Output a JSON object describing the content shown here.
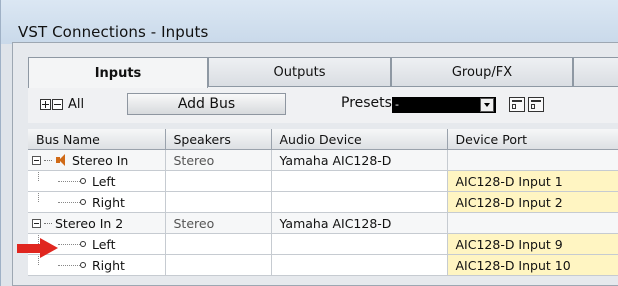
{
  "window": {
    "title": "VST Connections - Inputs"
  },
  "tabs": [
    {
      "label": "Inputs",
      "active": true
    },
    {
      "label": "Outputs",
      "active": false
    },
    {
      "label": "Group/FX",
      "active": false
    }
  ],
  "toolbar": {
    "expand_all_label": "All",
    "add_bus_label": "Add Bus",
    "presets_label": "Presets",
    "presets_value": "-"
  },
  "table": {
    "columns": [
      "Bus Name",
      "Speakers",
      "Audio Device",
      "Device Port"
    ],
    "rows": [
      {
        "type": "bus",
        "name": "Stereo In",
        "speakers": "Stereo",
        "device": "Yamaha AIC128-D",
        "port": ""
      },
      {
        "type": "channel",
        "name": "Left",
        "speakers": "",
        "device": "",
        "port": "AIC128-D Input 1"
      },
      {
        "type": "channel",
        "name": "Right",
        "speakers": "",
        "device": "",
        "port": "AIC128-D Input 2"
      },
      {
        "type": "bus",
        "name": "Stereo In 2",
        "speakers": "Stereo",
        "device": "Yamaha AIC128-D",
        "port": ""
      },
      {
        "type": "channel",
        "name": "Left",
        "speakers": "",
        "device": "",
        "port": "AIC128-D Input 9"
      },
      {
        "type": "channel",
        "name": "Right",
        "speakers": "",
        "device": "",
        "port": "AIC128-D Input 10"
      }
    ]
  },
  "colors": {
    "port_highlight": "#fff5c2",
    "arrow": "#e0261f",
    "speaker_icon": "#d06a17"
  }
}
